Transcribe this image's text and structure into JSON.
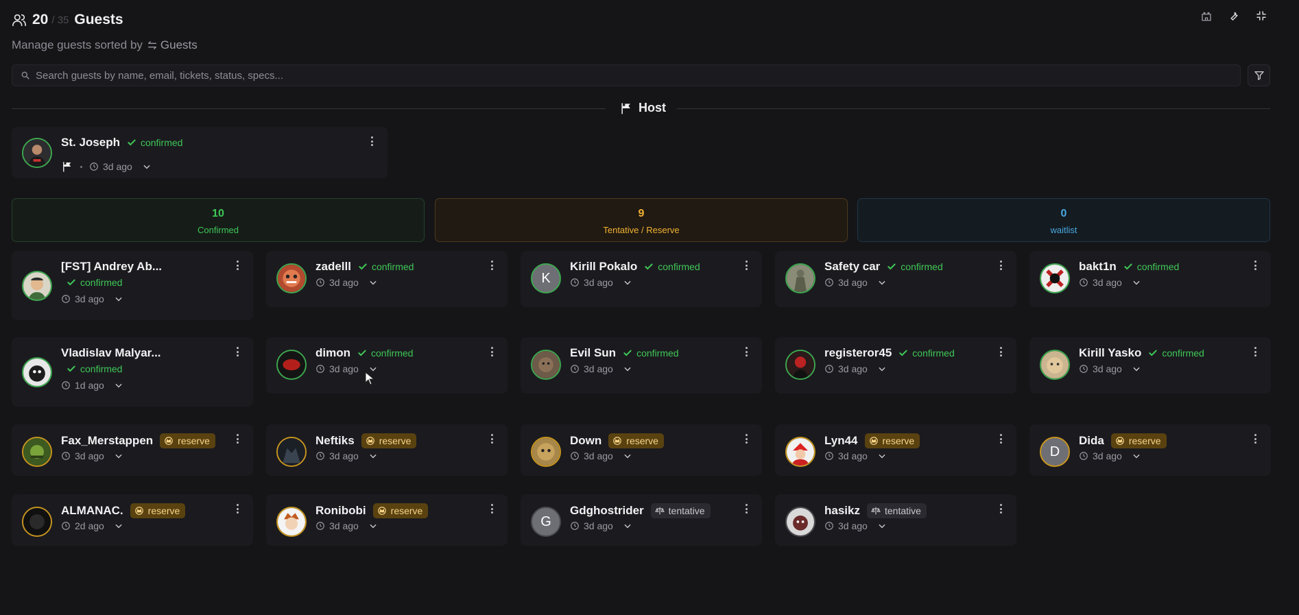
{
  "header": {
    "count": "20",
    "capacity": "/ 35",
    "title": "Guests",
    "subtitle": "Manage guests sorted by",
    "sort_label": "Guests"
  },
  "search": {
    "placeholder": "Search guests by name, email, tickets, status, specs..."
  },
  "divider": {
    "label": "Host"
  },
  "host": {
    "name": "St. Joseph",
    "status": "confirmed",
    "time": "3d ago"
  },
  "stats": {
    "confirmed": {
      "value": "10",
      "label": "Confirmed"
    },
    "tentative": {
      "value": "9",
      "label": "Tentative / Reserve"
    },
    "waitlist": {
      "value": "0",
      "label": "waitlist"
    }
  },
  "guests": [
    {
      "name": "[FST] Andrey Ab...",
      "status": "confirmed",
      "time": "3d ago"
    },
    {
      "name": "zadelll",
      "status": "confirmed",
      "time": "3d ago"
    },
    {
      "name": "Kirill Pokalo",
      "status": "confirmed",
      "time": "3d ago",
      "initial": "K"
    },
    {
      "name": "Safety car",
      "status": "confirmed",
      "time": "3d ago"
    },
    {
      "name": "bakt1n",
      "status": "confirmed",
      "time": "3d ago"
    },
    {
      "name": "Vladislav Malyar...",
      "status": "confirmed",
      "time": "1d ago"
    },
    {
      "name": "dimon",
      "status": "confirmed",
      "time": "3d ago"
    },
    {
      "name": "Evil Sun",
      "status": "confirmed",
      "time": "3d ago"
    },
    {
      "name": "registeror45",
      "status": "confirmed",
      "time": "3d ago"
    },
    {
      "name": "Kirill Yasko",
      "status": "confirmed",
      "time": "3d ago"
    },
    {
      "name": "Fax_Merstappen",
      "status": "reserve",
      "time": "3d ago"
    },
    {
      "name": "Neftiks",
      "status": "reserve",
      "time": "3d ago"
    },
    {
      "name": "Down",
      "status": "reserve",
      "time": "3d ago"
    },
    {
      "name": "Lyn44",
      "status": "reserve",
      "time": "3d ago"
    },
    {
      "name": "Dida",
      "status": "reserve",
      "time": "3d ago",
      "initial": "D"
    },
    {
      "name": "ALMANAC.",
      "status": "reserve",
      "time": "2d ago"
    },
    {
      "name": "Ronibobi",
      "status": "reserve",
      "time": "3d ago"
    },
    {
      "name": "Gdghostrider",
      "status": "tentative",
      "time": "3d ago",
      "initial": "G"
    },
    {
      "name": "hasikz",
      "status": "tentative",
      "time": "3d ago"
    }
  ],
  "colors": {
    "confirmed": "#3fc757",
    "reserve_bg": "#5a4210",
    "reserve_text": "#f7d486",
    "tentative": "#f2b233",
    "waitlist": "#49a8e0",
    "background": "#151518",
    "card": "#1b1b1f"
  },
  "icons": {
    "header": "users-icon",
    "sort": "sort-arrows-icon",
    "search": "search-icon",
    "filter": "filter-icon",
    "host": "flag-icon",
    "confirmed": "check-icon",
    "reserve": "crown-icon",
    "tentative": "scale-icon",
    "time": "clock-icon",
    "expand": "chevron-down-icon",
    "menu": "more-vertical-icon",
    "tools": [
      "castle-icon",
      "wrench-icon",
      "collapse-icon"
    ]
  }
}
